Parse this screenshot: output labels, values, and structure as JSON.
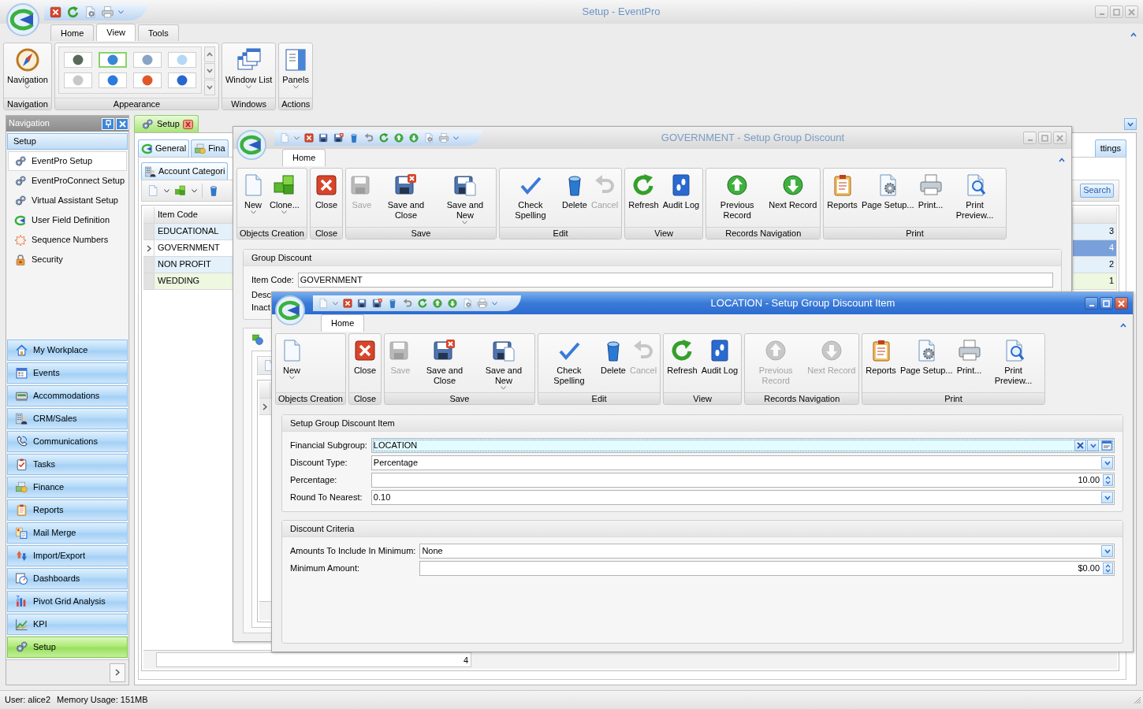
{
  "app": {
    "title": "Setup - EventPro",
    "tabs": [
      {
        "label": "Home",
        "selected": false
      },
      {
        "label": "View",
        "selected": true
      },
      {
        "label": "Tools",
        "selected": false
      }
    ],
    "ribbon_groups": [
      {
        "label": "Navigation",
        "kind": "buttons",
        "buttons": [
          {
            "label": "Navigation",
            "kind": "navigation",
            "dropdown": true,
            "disabled": false
          }
        ]
      },
      {
        "label": "Appearance",
        "kind": "gallery",
        "skins": [
          {
            "selected": false,
            "color": "#5a6a5a"
          },
          {
            "selected": true,
            "color": "#3a86d6"
          },
          {
            "selected": false,
            "color": "#8aa4c4"
          },
          {
            "selected": false,
            "color": "#b4d8f6"
          },
          {
            "selected": false,
            "color": "#c8c8c8"
          },
          {
            "selected": false,
            "color": "#2a7ae0"
          },
          {
            "selected": false,
            "color": "#e0582a"
          },
          {
            "selected": false,
            "color": "#2a66d0"
          }
        ]
      },
      {
        "label": "Windows",
        "kind": "buttons",
        "buttons": [
          {
            "label": "Window List",
            "kind": "window_list",
            "dropdown": true,
            "disabled": false
          }
        ]
      },
      {
        "label": "Actions",
        "kind": "buttons",
        "buttons": [
          {
            "label": "Panels",
            "kind": "panels",
            "dropdown": true,
            "disabled": false
          }
        ]
      }
    ]
  },
  "navigation": {
    "title": "Navigation",
    "section": "Setup",
    "items": [
      {
        "label": "EventPro Setup",
        "selected": true
      },
      {
        "label": "EventProConnect Setup",
        "selected": false
      },
      {
        "label": "Virtual Assistant Setup",
        "selected": false
      },
      {
        "label": "User Field Definition",
        "selected": false
      },
      {
        "label": "Sequence Numbers",
        "selected": false
      },
      {
        "label": "Security",
        "selected": false
      }
    ],
    "modules": [
      {
        "label": "My Workplace",
        "selected": false
      },
      {
        "label": "Events",
        "selected": false
      },
      {
        "label": "Accommodations",
        "selected": false
      },
      {
        "label": "CRM/Sales",
        "selected": false
      },
      {
        "label": "Communications",
        "selected": false
      },
      {
        "label": "Tasks",
        "selected": false
      },
      {
        "label": "Finance",
        "selected": false
      },
      {
        "label": "Reports",
        "selected": false
      },
      {
        "label": "Mail Merge",
        "selected": false
      },
      {
        "label": "Import/Export",
        "selected": false
      },
      {
        "label": "Dashboards",
        "selected": false
      },
      {
        "label": "Pivot Grid Analysis",
        "selected": false
      },
      {
        "label": "KPI",
        "selected": false
      },
      {
        "label": "Setup",
        "selected": true
      }
    ]
  },
  "document": {
    "tab": "Setup",
    "tabs": [
      {
        "label": "General",
        "selected": true
      },
      {
        "label": "Fina",
        "selected": false
      },
      {
        "label": "ttings",
        "selected": false
      }
    ],
    "subtab": "Account Categori",
    "search_button": "Search",
    "grid": {
      "columns": [
        "Item Code"
      ],
      "rows": [
        {
          "item_code": "EDUCATIONAL",
          "column_2": "3",
          "selected": false
        },
        {
          "item_code": "GOVERNMENT",
          "column_2": "4",
          "selected": true
        },
        {
          "item_code": "NON PROFIT",
          "column_2": "2",
          "selected": false
        },
        {
          "item_code": "WEDDING",
          "column_2": "1",
          "selected": false
        }
      ],
      "footer": "4"
    }
  },
  "windows": [
    {
      "title": "GOVERNMENT - Setup Group Discount",
      "active": false,
      "tab": "Home",
      "ribbon_groups": [
        {
          "label": "Objects Creation",
          "buttons": [
            {
              "label": "New",
              "kind": "new",
              "dropdown": true,
              "disabled": false
            },
            {
              "label": "Clone...",
              "kind": "clone",
              "dropdown": true,
              "disabled": false
            }
          ]
        },
        {
          "label": "Close",
          "buttons": [
            {
              "label": "Close",
              "kind": "close",
              "dropdown": false,
              "disabled": false
            }
          ]
        },
        {
          "label": "Save",
          "buttons": [
            {
              "label": "Save",
              "kind": "save",
              "dropdown": false,
              "disabled": true
            },
            {
              "label": "Save and Close",
              "kind": "save_close",
              "dropdown": false,
              "disabled": false
            },
            {
              "label": "Save and New",
              "kind": "save_new",
              "dropdown": true,
              "disabled": false
            }
          ]
        },
        {
          "label": "Edit",
          "buttons": [
            {
              "label": "Check Spelling",
              "kind": "spelling",
              "dropdown": false,
              "disabled": false
            },
            {
              "label": "Delete",
              "kind": "delete",
              "dropdown": false,
              "disabled": false
            },
            {
              "label": "Cancel",
              "kind": "cancel",
              "dropdown": false,
              "disabled": true
            }
          ]
        },
        {
          "label": "View",
          "buttons": [
            {
              "label": "Refresh",
              "kind": "refresh",
              "dropdown": false,
              "disabled": false
            },
            {
              "label": "Audit Log",
              "kind": "audit",
              "dropdown": false,
              "disabled": false
            }
          ]
        },
        {
          "label": "Records Navigation",
          "buttons": [
            {
              "label": "Previous Record",
              "kind": "previous",
              "dropdown": false,
              "disabled": false
            },
            {
              "label": "Next Record",
              "kind": "next",
              "dropdown": false,
              "disabled": false
            }
          ]
        },
        {
          "label": "Print",
          "buttons": [
            {
              "label": "Reports",
              "kind": "reports",
              "dropdown": false,
              "disabled": false
            },
            {
              "label": "Page Setup...",
              "kind": "page_setup",
              "dropdown": false,
              "disabled": false
            },
            {
              "label": "Print...",
              "kind": "print",
              "dropdown": false,
              "disabled": false
            },
            {
              "label": "Print Preview...",
              "kind": "preview",
              "dropdown": false,
              "disabled": false
            }
          ]
        }
      ],
      "sections": [
        {
          "title": "Group Discount",
          "fields": [
            {
              "label": "Item Code:",
              "kind": "text",
              "value": "GOVERNMENT",
              "focused": false
            },
            {
              "label": "Desc",
              "kind": "label"
            },
            {
              "label": "Inact",
              "kind": "label"
            }
          ]
        }
      ],
      "detail_grid": {
        "rows": [
          {
            "selected": true
          }
        ]
      }
    },
    {
      "title": "LOCATION - Setup Group Discount Item",
      "active": true,
      "tab": "Home",
      "ribbon_groups": [
        {
          "label": "Objects Creation",
          "buttons": [
            {
              "label": "New",
              "kind": "new",
              "dropdown": true,
              "disabled": false
            }
          ]
        },
        {
          "label": "Close",
          "buttons": [
            {
              "label": "Close",
              "kind": "close",
              "dropdown": false,
              "disabled": false
            }
          ]
        },
        {
          "label": "Save",
          "buttons": [
            {
              "label": "Save",
              "kind": "save",
              "dropdown": false,
              "disabled": true
            },
            {
              "label": "Save and Close",
              "kind": "save_close",
              "dropdown": false,
              "disabled": false
            },
            {
              "label": "Save and New",
              "kind": "save_new",
              "dropdown": true,
              "disabled": false
            }
          ]
        },
        {
          "label": "Edit",
          "buttons": [
            {
              "label": "Check Spelling",
              "kind": "spelling",
              "dropdown": false,
              "disabled": false
            },
            {
              "label": "Delete",
              "kind": "delete",
              "dropdown": false,
              "disabled": false
            },
            {
              "label": "Cancel",
              "kind": "cancel",
              "dropdown": false,
              "disabled": true
            }
          ]
        },
        {
          "label": "View",
          "buttons": [
            {
              "label": "Refresh",
              "kind": "refresh",
              "dropdown": false,
              "disabled": false
            },
            {
              "label": "Audit Log",
              "kind": "audit",
              "dropdown": false,
              "disabled": false
            }
          ]
        },
        {
          "label": "Records Navigation",
          "buttons": [
            {
              "label": "Previous Record",
              "kind": "previous",
              "dropdown": false,
              "disabled": true
            },
            {
              "label": "Next Record",
              "kind": "next",
              "dropdown": false,
              "disabled": true
            }
          ]
        },
        {
          "label": "Print",
          "buttons": [
            {
              "label": "Reports",
              "kind": "reports",
              "dropdown": false,
              "disabled": false
            },
            {
              "label": "Page Setup...",
              "kind": "page_setup",
              "dropdown": false,
              "disabled": false
            },
            {
              "label": "Print...",
              "kind": "print",
              "dropdown": false,
              "disabled": false
            },
            {
              "label": "Print Preview...",
              "kind": "preview",
              "dropdown": false,
              "disabled": false
            }
          ]
        }
      ],
      "sections": [
        {
          "title": "Setup Group Discount Item",
          "fields": [
            {
              "label": "Financial Subgroup:",
              "kind": "lookup",
              "value": "LOCATION",
              "focused": true
            },
            {
              "label": "Discount Type:",
              "kind": "combo",
              "value": "Percentage",
              "focused": false
            },
            {
              "label": "Percentage:",
              "kind": "spin",
              "value": "10.00",
              "focused": false
            },
            {
              "label": "Round To Nearest:",
              "kind": "combo",
              "value": "0.10",
              "focused": false
            }
          ]
        },
        {
          "title": "Discount Criteria",
          "fields": [
            {
              "label": "Amounts To Include In Minimum:",
              "kind": "combo",
              "value": "None",
              "focused": false
            },
            {
              "label": "Minimum Amount:",
              "kind": "spin",
              "value": "$0.00",
              "focused": false
            }
          ]
        }
      ]
    }
  ],
  "status_bar": {
    "user": "User: alice2",
    "memory": "Memory Usage: 151MB"
  }
}
